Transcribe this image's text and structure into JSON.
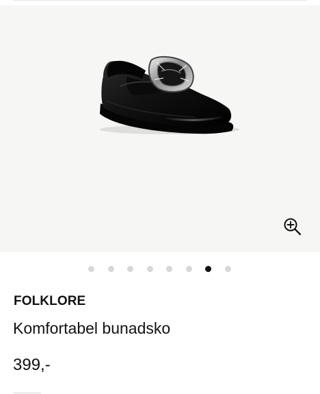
{
  "product": {
    "brand": "FOLKLORE",
    "name": "Komfortabel bunadsko",
    "price": "399,-"
  },
  "gallery": {
    "image_icon": "black-leather-buckle-shoe",
    "zoom_icon": "zoom-in-icon",
    "total_images": 8,
    "active_index": 6,
    "background_color": "#f6f6f5"
  },
  "colors": {
    "text": "#111111",
    "dot_inactive": "#d7d7d7",
    "dot_active": "#111111"
  }
}
